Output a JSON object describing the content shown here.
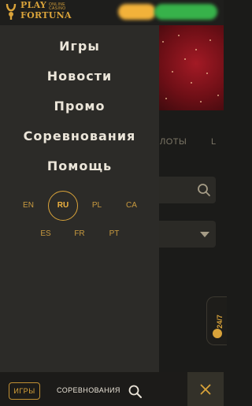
{
  "header": {
    "logo": {
      "line1": "PLAY",
      "line2": "ONLINE CASINO",
      "line3": "FORTUNA"
    }
  },
  "background": {
    "tabs": [
      "ЛОТЫ",
      "L"
    ]
  },
  "support": {
    "label": "24/7"
  },
  "menu": {
    "items": [
      "Игры",
      "Новости",
      "Промо",
      "Соревнования",
      "Помощь"
    ]
  },
  "languages": {
    "row1": [
      "EN",
      "RU",
      "PL",
      "CA"
    ],
    "row2": [
      "ES",
      "FR",
      "PT"
    ],
    "selected": "RU"
  },
  "bottom_bar": {
    "games_label": "ИГРЫ",
    "competitions_label": "СОРЕВНОВАНИЯ",
    "search_icon": "search-icon",
    "close_icon": "close-icon"
  },
  "colors": {
    "accent": "#d9a33a",
    "drawer_bg": "#2c2b28",
    "page_bg": "#1b1b19",
    "menu_text": "#ebe5d9"
  }
}
